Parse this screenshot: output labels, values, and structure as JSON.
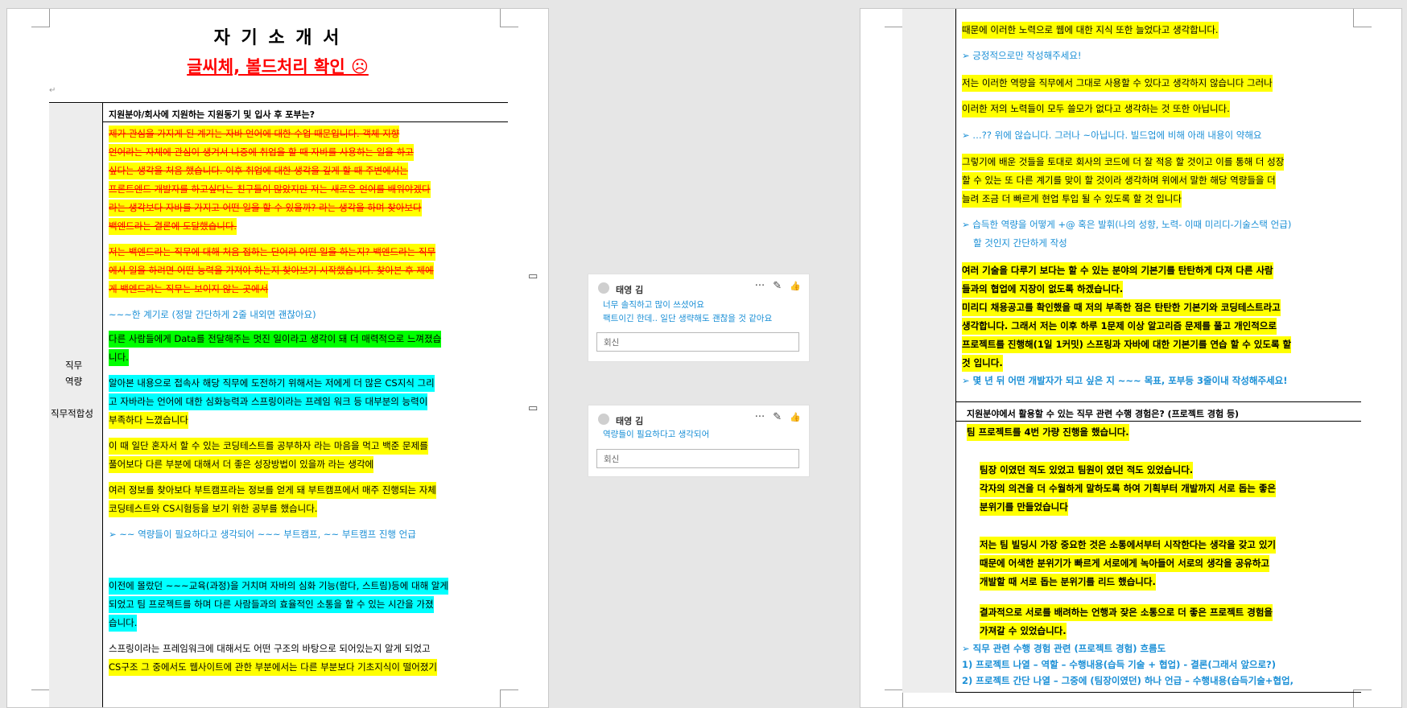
{
  "page1": {
    "title": "자 기 소 개 서",
    "subtitle": "글씨체, 볼드처리 확인 ☹",
    "section_header": "지원분야/회사에 지원하는 지원동기 및 입사 후 포부는?",
    "side_labels": [
      "직무",
      "역량",
      "직무적합성"
    ],
    "lines": [
      "제가 관심을 가지게 된 계기는 자바 언어에 대한 수업 때문입니다. 객체 지향",
      "언어라는 자체에 관심이 생겨서 나중에 취업을 할 때 자바를 사용하는 일을 하고",
      "싶다는 생각을 처음 했습니다. 이후 취업에 대한 생각을 깊게 할 때 주변에서는",
      "프론트엔드 개발자를 하고싶다는 친구들이 많았지만 저는 새로운 언어를 배워야겠다",
      "라는 생각보다 자바를 가지고 어떤 일을 할 수 있을까? 라는 생각을 하며 찾아보다",
      "백엔드라는 결론에 도달했습니다.",
      "저는 백엔드라는 직무에 대해 처음 접하는 단어라 어떤 일을 하는지? 백엔드라는 직무",
      "에서 일을 하려면 어떤 능력을 가져야 하는지 찾아보기 시작했습니다. 찾아본 후 제에",
      "게 백엔드라는 직무는 보이지 않는 곳에서",
      "~~~한 계기로 (정말 간단하게 2줄 내외면 괜찮아요)",
      "다른 사람들에게 Data를 전달해주는 멋진 일이라고 생각이 돼 더 매력적으로 느껴졌습",
      "니다.",
      "알아본 내용으로 접속사 해당 직무에 도전하기 위해서는 저에게 더 많은 CS지식 그리",
      "고 자바라는 언어에 대한 심화능력과 스프링이라는 프레임 워크 등 대부분의 능력이",
      "부족하다 느꼈습니다",
      "이 때 일단 혼자서 할 수 있는 코딩테스트를 공부하자 라는 마음을 먹고 백준 문제를",
      "풀어보다 다른 부분에 대해서 더 좋은 성장방법이 있을까 라는 생각에",
      "여러 정보를 찾아보다 부트캠프라는 정보를 얻게 돼 부트캠프에서 매주 진행되는 자체",
      "코딩테스트와 CS시험등을 보기 위한 공부를 했습니다.",
      "➢  ~~ 역량들이 필요하다고 생각되어 ~~~ 부트캠프, ~~ 부트캠프 진행 언급",
      "이전에 몰랐던 ~~~교육(과정)을 거치며 자바의 심화 기능(람다, 스트림)등에 대해 알게",
      "되었고 팀 프로젝트를 하며 다른 사람들과의 효율적인 소통을 할 수 있는 시간을 가졌",
      "습니다.",
      "스프링이라는 프레임워크에 대해서도 어떤 구조의 바탕으로 되어있는지 알게 되었고",
      "CS구조 그 중에서도 웹사이트에 관한 부분에서는 다른 부분보다 기초지식이 떨어졌기"
    ]
  },
  "comments": [
    {
      "author": "태영 김",
      "lines": [
        "너무 솔직하고 많이 쓰셨어요",
        "팩트이긴 한데.. 일단 생략해도 괜찮을 것 같아요"
      ],
      "reply_placeholder": "회신"
    },
    {
      "author": "태영 김",
      "lines": [
        "역량들이 필요하다고 생각되어"
      ],
      "reply_placeholder": "회신"
    }
  ],
  "comment_icons": {
    "more": "···",
    "edit": "✎",
    "like": "👍"
  },
  "page2": {
    "section_header": "지원분야에서 활용할 수 있는 직무 관련 수행 경험은? (프로젝트 경험 등)",
    "lines": [
      "때문에 이러한 노력으로 웹에 대한 지식 또한 늘었다고 생각합니다.",
      "➢  긍정적으로만 작성해주세요!",
      "저는 이러한 역량을 직무에서 그대로 사용할 수 있다고 생각하지 않습니다 그러나",
      "이러한 저의 노력들이 모두 쓸모가 없다고 생각하는 것 또한 아닙니다.",
      "➢  …?? 위에 않습니다. 그러나 ~아닙니다. 빌드업에 비해 아래 내용이 약해요",
      "그렇기에 배운 것들을 토대로 회사의 코드에 더 잘 적응 할 것이고 이를 통해 더 성장",
      "할 수 있는 또 다른 계기를 맞이 할 것이라 생각하며 위에서 말한 해당 역량들을 더",
      "늘려 조금 더 빠르게 현업 투입 될 수 있도록 할 것 입니다",
      "➢  습득한 역량을 어떻게 +@ 혹은 발휘(나의 성향, 노력- 이때 미리디-기술스택 언급)",
      "할 것인지 간단하게 작성",
      "여러 기술을 다루기 보다는 할 수 있는 분야의 기본기를 탄탄하게 다져 다른 사람",
      "들과의 협업에 지장이 없도록 하겠습니다.",
      "미리디 채용공고를 확인했을 때 저의 부족한 점은 탄탄한 기본기와 코딩테스트라고",
      "생각합니다. 그래서 저는 이후 하루 1문제 이상 알고리즘 문제를 풀고 개인적으로",
      "프로젝트를 진행해(1일 1커밋) 스프링과 자바에 대한 기본기를 연습 할 수 있도록 할",
      "것 입니다.",
      "➢  몇 년 뒤 어떤 개발자가 되고 싶은 지 ~~~ 목표, 포부등 3줄이내 작성해주세요!",
      "팀 프로젝트를 4번 가량 진행을 했습니다.",
      "팀장 이였던 적도 있었고 팀원이 였던 적도 있었습니다.",
      "각자의 의견을 더 수월하게 말하도록 하여 기획부터 개발까지 서로 돕는 좋은",
      "분위기를 만들었습니다",
      "저는 팀 빌딩시 가장 중요한 것은 소통에서부터 시작한다는 생각을 갖고 있기",
      "때문에 어색한 분위기가 빠르게 서로에게 녹아들어 서로의 생각을 공유하고",
      "개발할 때 서로 돕는 분위기를 리드 했습니다.",
      "결과적으로 서로를 배려하는 언행과 잦은 소통으로 더 좋은 프로젝트 경험을",
      "가져갈 수 있었습니다.",
      "➢  직무 관련 수행 경험 관련 (프로젝트 경험) 흐름도",
      "1) 프로젝트 나열 – 역할 – 수행내용(습득 기술 + 협업) - 결론(그래서 앞으로?)",
      "2) 프로젝트 간단 나열 – 그중에 (팀장이였던) 하나 언급 – 수행내용(습득기술+협업,"
    ]
  }
}
